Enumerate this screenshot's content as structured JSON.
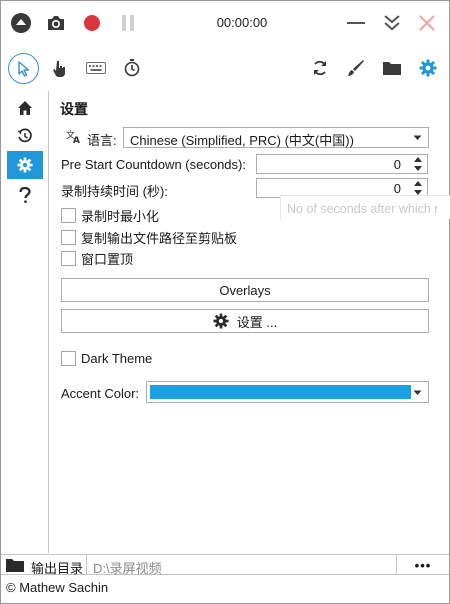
{
  "topbar": {
    "timer": "00:00:00",
    "icons": [
      "eject-icon",
      "camera-icon",
      "record-icon",
      "pause-icon",
      "minimize-icon",
      "collapse-icon",
      "close-icon"
    ]
  },
  "toolbar": {
    "left_tools": [
      "cursor-icon",
      "hand-icon",
      "keyboard-icon",
      "stopwatch-icon"
    ],
    "right_tools": [
      "refresh-icon",
      "brush-icon",
      "folder-icon",
      "gear-icon"
    ]
  },
  "sidenav": {
    "items": [
      "home-icon",
      "history-icon",
      "gear-icon",
      "help-icon"
    ],
    "active": "gear-icon"
  },
  "settings": {
    "title": "设置",
    "language_label": "语言:",
    "language_value": "Chinese (Simplified, PRC) (中文(中国))",
    "countdown_label": "Pre Start Countdown (seconds):",
    "countdown_value": "0",
    "duration_label": "录制持续时间 (秒):",
    "duration_value": "0",
    "tooltip_text": "No of seconds after which r",
    "checkboxes": [
      {
        "label": "录制时最小化",
        "checked": false
      },
      {
        "label": "复制输出文件路径至剪贴板",
        "checked": false
      },
      {
        "label": "窗口置顶",
        "checked": false
      }
    ],
    "overlays_button": "Overlays",
    "settings_button": "设置 ...",
    "dark_theme_label": "Dark Theme",
    "dark_theme_checked": false,
    "accent_label": "Accent Color:",
    "accent_color": "#1ba1e2"
  },
  "output": {
    "label": "输出目录",
    "path_placeholder": "D:\\录屏视频",
    "more_button": "•••"
  },
  "footer": {
    "copyright": "© Mathew Sachin"
  },
  "colors": {
    "accent": "#1f97d8",
    "record_red": "#d9363e",
    "close_red": "#f0a3a3"
  }
}
